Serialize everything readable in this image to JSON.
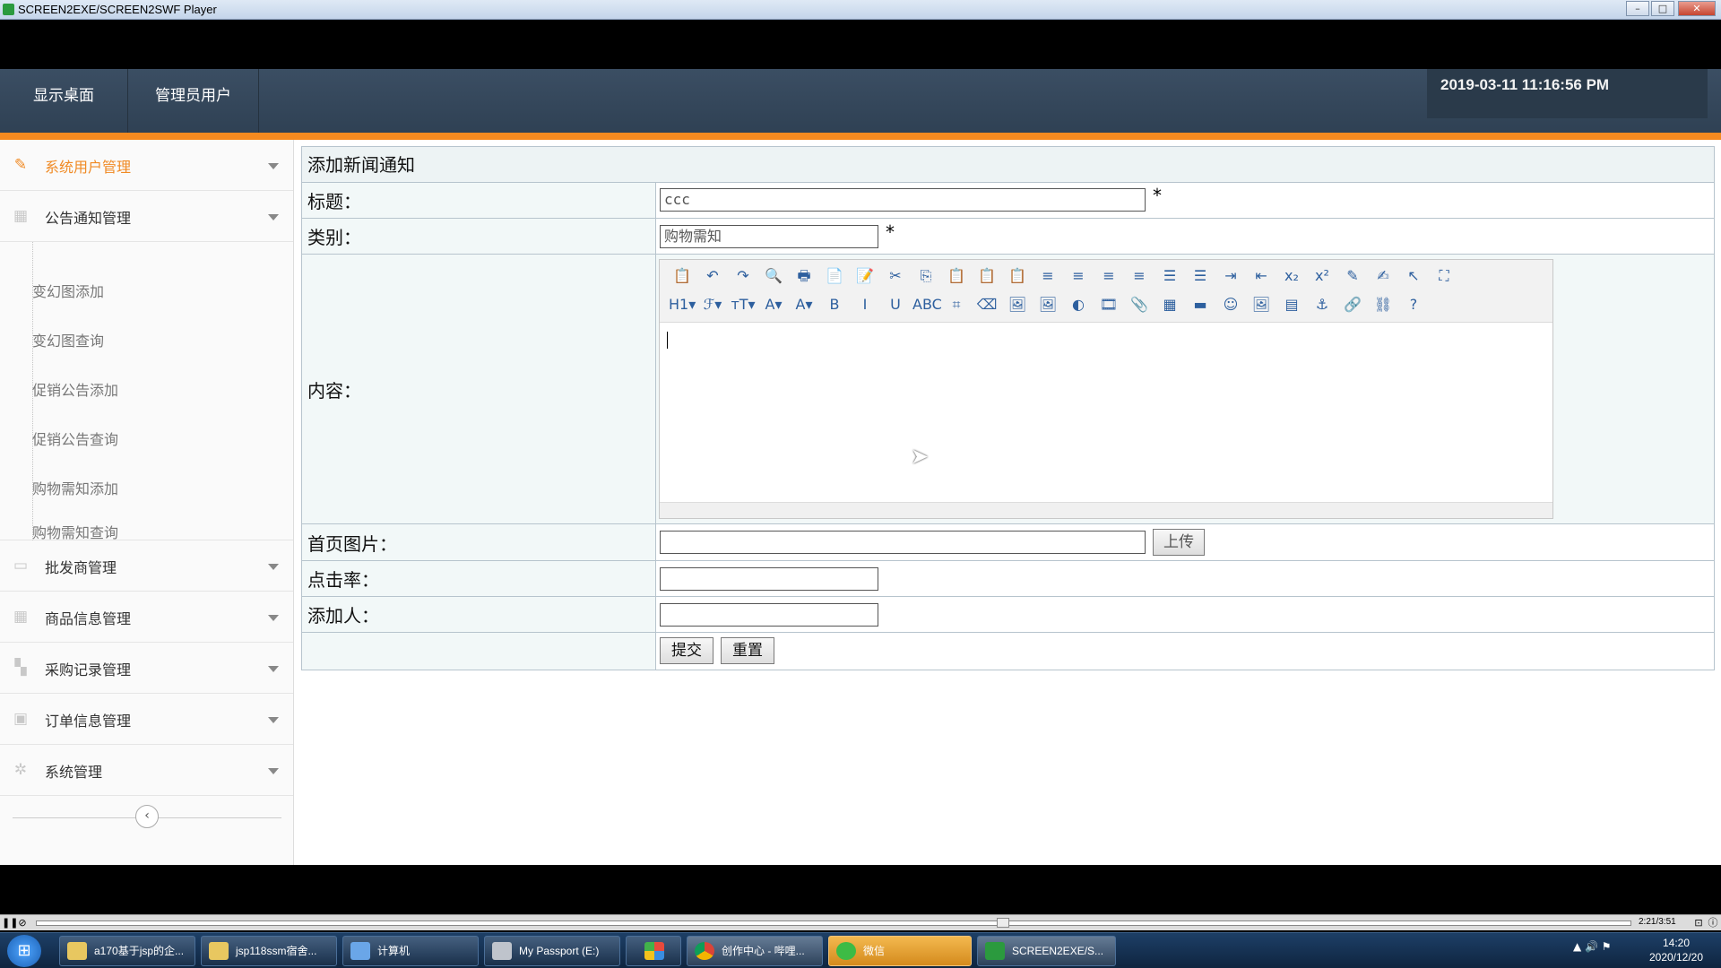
{
  "player": {
    "title": "SCREEN2EXE/SCREEN2SWF Player",
    "time": "2:21/3:51"
  },
  "topnav": {
    "items": [
      "显示桌面",
      "管理员用户"
    ],
    "clock": "2019-03-11 11:16:56 PM"
  },
  "sidebar": {
    "menus": [
      {
        "label": "系统用户管理",
        "icon": "pencil-icon"
      },
      {
        "label": "公告通知管理",
        "icon": "grid-icon"
      },
      {
        "label": "批发商管理",
        "icon": "monitor-icon"
      },
      {
        "label": "商品信息管理",
        "icon": "grid-icon"
      },
      {
        "label": "采购记录管理",
        "icon": "blocks-icon"
      },
      {
        "label": "订单信息管理",
        "icon": "calendar-icon"
      },
      {
        "label": "系统管理",
        "icon": "gear-icon"
      }
    ],
    "submenu": [
      "变幻图添加",
      "变幻图查询",
      "促销公告添加",
      "促销公告查询",
      "购物需知添加",
      "购物需知查询"
    ],
    "collapse": "‹"
  },
  "form": {
    "title": "添加新闻通知",
    "fields": {
      "title_label": "标题：",
      "title_value": "ccc",
      "category_label": "类别：",
      "category_value": "购物需知",
      "content_label": "内容：",
      "image_label": "首页图片：",
      "image_value": "",
      "clicks_label": "点击率：",
      "clicks_value": "",
      "author_label": "添加人：",
      "author_value": ""
    },
    "required_mark": "*",
    "upload": "上传",
    "submit": "提交",
    "reset": "重置"
  },
  "editor": {
    "row1": [
      "📋",
      "↶",
      "↷",
      "🔍",
      "🖶",
      "📄",
      "📝",
      "✂",
      "⎘",
      "📋",
      "📋",
      "📋",
      "≡",
      "≡",
      "≡",
      "≡",
      "☰",
      "☰",
      "⇥",
      "⇤",
      "x₂",
      "x²",
      "✎",
      "✍",
      "↖",
      "⛶"
    ],
    "row2": [
      "H1▾",
      "ℱ▾",
      "тT▾",
      "A▾",
      "A▾",
      "B",
      "I",
      "U",
      "ABC",
      "⌗",
      "⌫",
      "🖼",
      "🖼",
      "◐",
      "🎞",
      "📎",
      "▦",
      "▬",
      "☺",
      "🖼",
      "▤",
      "⚓",
      "🔗",
      "⛓",
      "?"
    ]
  },
  "taskbar": {
    "start": "⊞",
    "tasks": [
      {
        "label": "a170基于jsp的企..."
      },
      {
        "label": "jsp118ssm宿舍..."
      },
      {
        "label": "计算机"
      },
      {
        "label": "My Passport (E:)"
      },
      {
        "label": ""
      },
      {
        "label": "创作中心 - 哔哩..."
      },
      {
        "label": "微信"
      },
      {
        "label": "SCREEN2EXE/S..."
      }
    ],
    "clock_time": "14:20",
    "clock_date": "2020/12/20",
    "tray": "▲ 🔊 ⚑"
  }
}
